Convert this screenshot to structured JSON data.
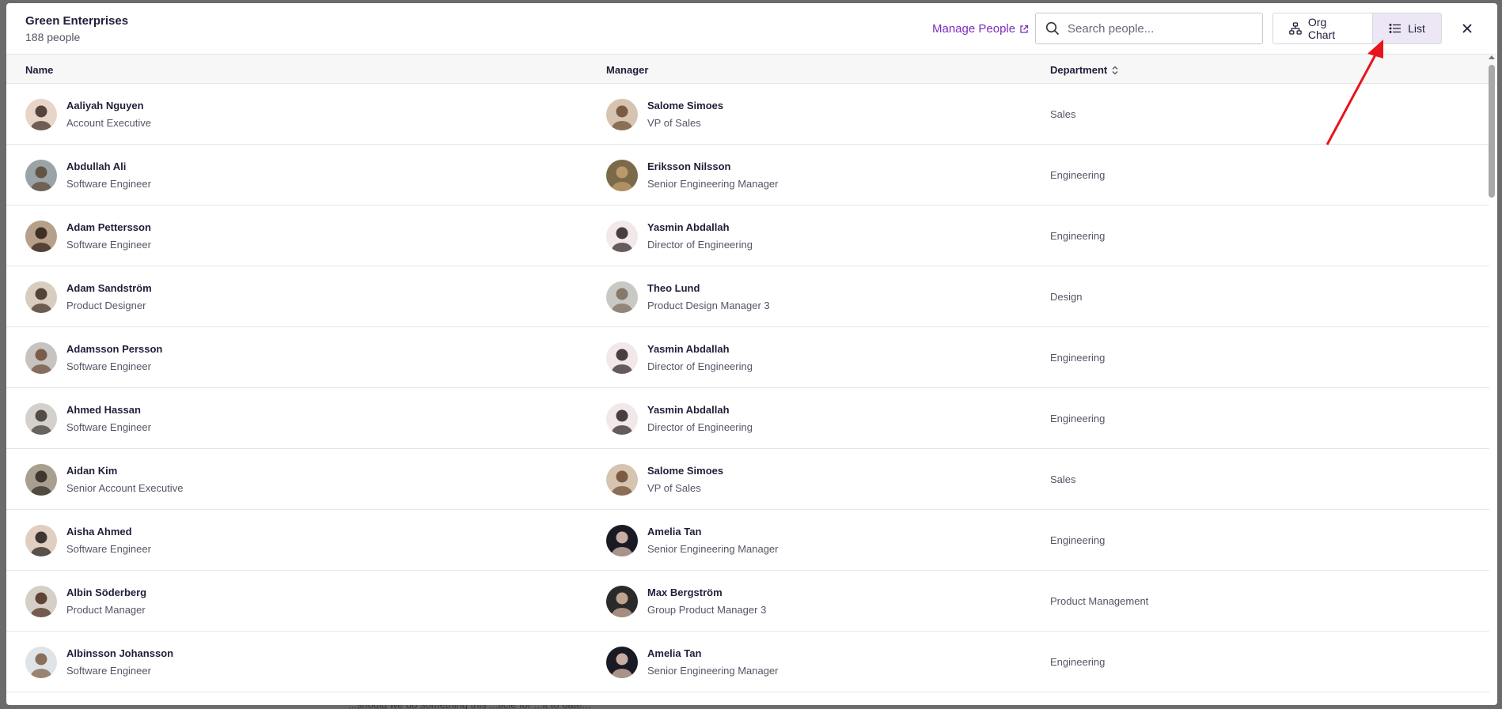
{
  "header": {
    "company_name": "Green Enterprises",
    "people_count": "188 people",
    "manage_link": "Manage People",
    "search_placeholder": "Search people...",
    "org_chart_label": "Org Chart",
    "list_label": "List",
    "active_view": "List"
  },
  "table": {
    "columns": {
      "name": "Name",
      "manager": "Manager",
      "department": "Department"
    },
    "rows": [
      {
        "name": "Aaliyah Nguyen",
        "title": "Account Executive",
        "manager": "Salome Simoes",
        "manager_title": "VP of Sales",
        "department": "Sales"
      },
      {
        "name": "Abdullah Ali",
        "title": "Software Engineer",
        "manager": "Eriksson Nilsson",
        "manager_title": "Senior Engineering Manager",
        "department": "Engineering"
      },
      {
        "name": "Adam Pettersson",
        "title": "Software Engineer",
        "manager": "Yasmin Abdallah",
        "manager_title": "Director of Engineering",
        "department": "Engineering"
      },
      {
        "name": "Adam Sandström",
        "title": "Product Designer",
        "manager": "Theo Lund",
        "manager_title": "Product Design Manager 3",
        "department": "Design"
      },
      {
        "name": "Adamsson Persson",
        "title": "Software Engineer",
        "manager": "Yasmin Abdallah",
        "manager_title": "Director of Engineering",
        "department": "Engineering"
      },
      {
        "name": "Ahmed Hassan",
        "title": "Software Engineer",
        "manager": "Yasmin Abdallah",
        "manager_title": "Director of Engineering",
        "department": "Engineering"
      },
      {
        "name": "Aidan Kim",
        "title": "Senior Account Executive",
        "manager": "Salome Simoes",
        "manager_title": "VP of Sales",
        "department": "Sales"
      },
      {
        "name": "Aisha Ahmed",
        "title": "Software Engineer",
        "manager": "Amelia Tan",
        "manager_title": "Senior Engineering Manager",
        "department": "Engineering"
      },
      {
        "name": "Albin Söderberg",
        "title": "Product Manager",
        "manager": "Max Bergström",
        "manager_title": "Group Product Manager 3",
        "department": "Product Management"
      },
      {
        "name": "Albinsson Johansson",
        "title": "Software Engineer",
        "manager": "Amelia Tan",
        "manager_title": "Senior Engineering Manager",
        "department": "Engineering"
      }
    ]
  },
  "backdrop_text": "...should we do something this ...ticle for ...it to date...",
  "colors": {
    "accent": "#7b2cbf",
    "active_toggle_bg": "#ece6f5",
    "annotation_arrow": "#e8141c"
  }
}
